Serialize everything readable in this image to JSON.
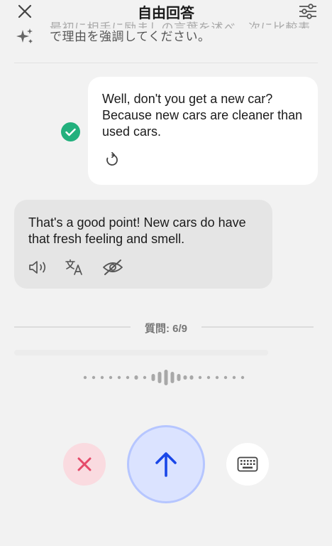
{
  "header": {
    "title": "自由回答",
    "close_icon": "close-icon",
    "settings_icon": "sliders-icon"
  },
  "hint": {
    "icon": "sparkles-icon",
    "line1": "最初に相手に励ましの言葉を述べ、次に比較表",
    "line2": "で理由を強調してください。"
  },
  "conversation": {
    "user_message": "Well, don't you get a new car? Because new cars are cleaner than used cars.",
    "user_status_icon": "check-icon",
    "user_action_icon": "retry-icon",
    "ai_message": "That's a good point! New cars do have that fresh feeling and smell.",
    "ai_actions": [
      "speaker-icon",
      "translate-icon",
      "eye-off-icon"
    ]
  },
  "progress": {
    "label": "質問: 6/9",
    "current": 6,
    "total": 9
  },
  "recording": {
    "waveform_icon": "audio-waveform"
  },
  "controls": {
    "cancel_icon": "x-icon",
    "send_icon": "arrow-up-icon",
    "keyboard_icon": "keyboard-icon"
  },
  "colors": {
    "background": "#f2f2f2",
    "user_bubble": "#ffffff",
    "ai_bubble": "#e5e5e5",
    "success": "#22b07d",
    "cancel": "#e54b6a",
    "cancel_bg": "#fadbe0",
    "send": "#1a47e8",
    "send_bg": "#dbe3ff"
  }
}
